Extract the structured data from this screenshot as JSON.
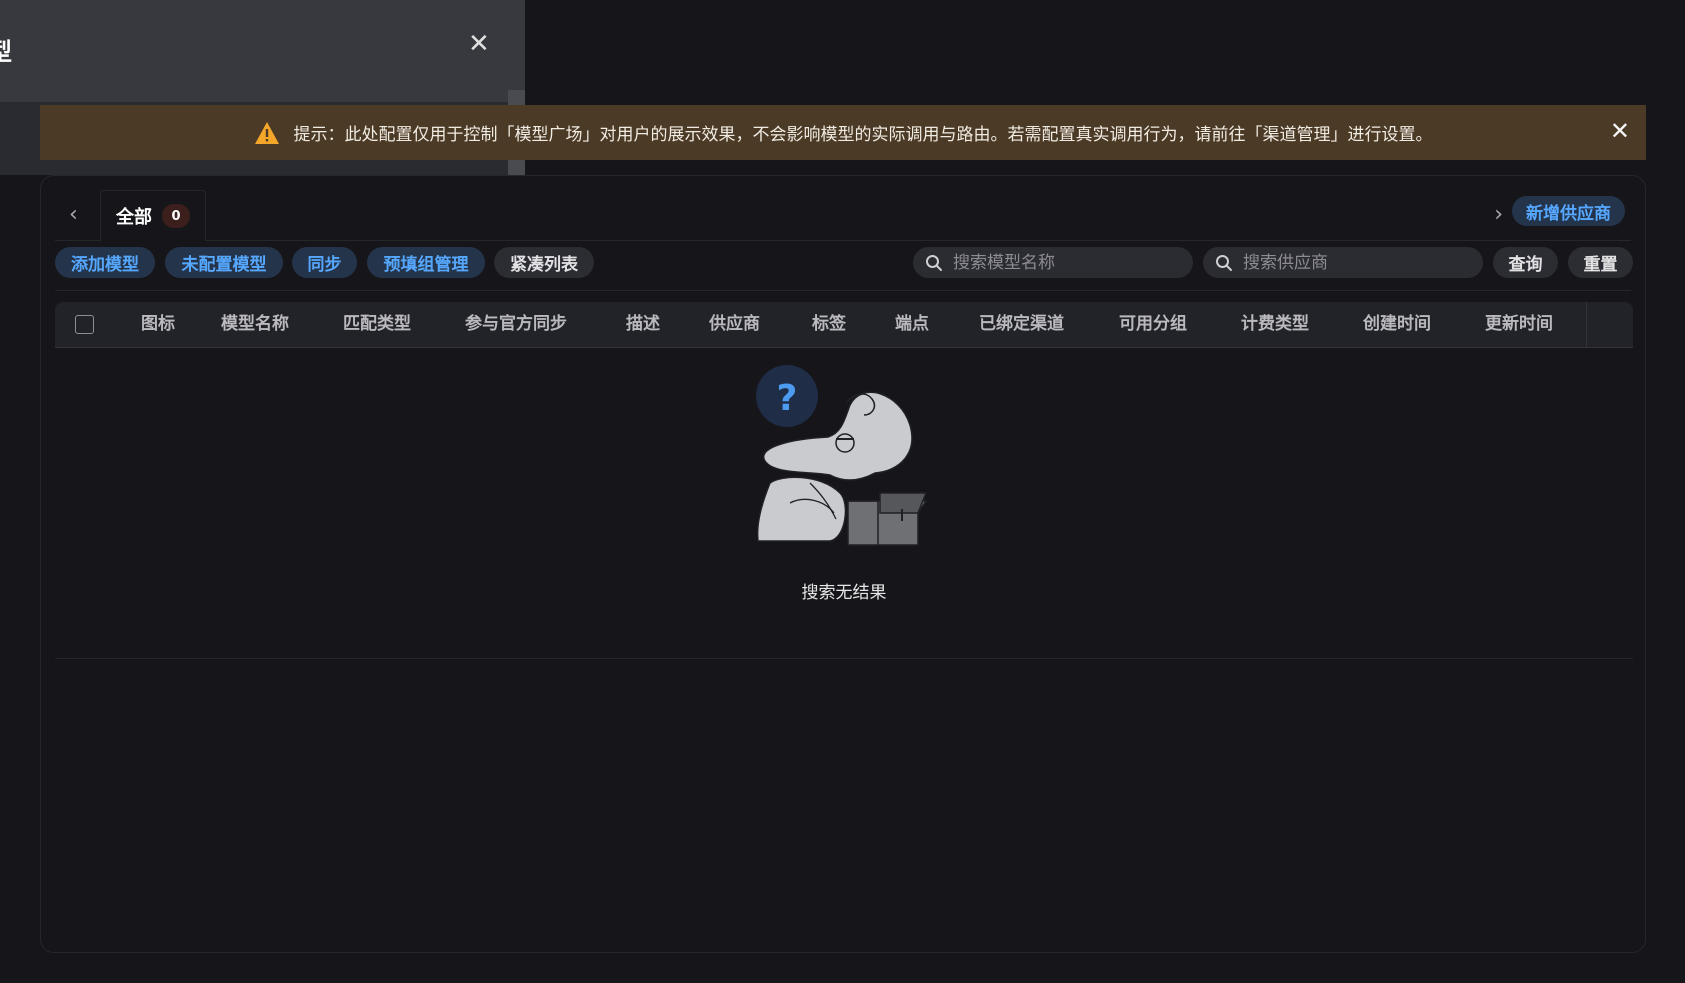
{
  "drawer": {
    "title": "型",
    "close_icon": "close-icon"
  },
  "banner": {
    "icon": "warning-icon",
    "text": "提示：此处配置仅用于控制「模型广场」对用户的展示效果，不会影响模型的实际调用与路由。若需配置真实调用行为，请前往「渠道管理」进行设置。",
    "close_icon": "close-icon",
    "colors": {
      "background": "#4b3a25",
      "icon": "#f4a62a"
    }
  },
  "tabs": {
    "prev_icon": "chevron-left-icon",
    "next_icon": "chevron-right-icon",
    "all_label": "全部",
    "all_count": "0",
    "add_provider_label": "新增供应商"
  },
  "toolbar": {
    "add_model": "添加模型",
    "unconfigured_models": "未配置模型",
    "sync": "同步",
    "prefill_group": "预填组管理",
    "compact_list": "紧凑列表",
    "search_model_placeholder": "搜索模型名称",
    "search_provider_placeholder": "搜索供应商",
    "query": "查询",
    "reset": "重置"
  },
  "table": {
    "columns": [
      "图标",
      "模型名称",
      "匹配类型",
      "参与官方同步",
      "描述",
      "供应商",
      "标签",
      "端点",
      "已绑定渠道",
      "可用分组",
      "计费类型",
      "创建时间",
      "更新时间"
    ],
    "rows": [],
    "empty_text": "搜索无结果"
  },
  "colors": {
    "page_bg": "#16161a",
    "accent_blue": "#56a8ff",
    "pill_blue_bg": "#24344a",
    "badge_bg": "#3c1f1c"
  }
}
